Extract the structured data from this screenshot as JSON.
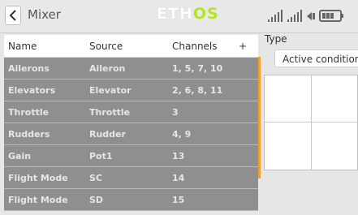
{
  "header": {
    "title": "Mixer",
    "logo_main": "ETH",
    "logo_accent": "OS"
  },
  "table": {
    "columns": [
      "Name",
      "Source",
      "Channels",
      "+"
    ],
    "rows": [
      {
        "name": "Ailerons",
        "source": "Aileron",
        "channels": "1, 5, 7, 10"
      },
      {
        "name": "Elevators",
        "source": "Elevator",
        "channels": "2, 6, 8, 11"
      },
      {
        "name": "Throttle",
        "source": "Throttle",
        "channels": "3"
      },
      {
        "name": "Rudders",
        "source": "Rudder",
        "channels": "4, 9"
      },
      {
        "name": "Gain",
        "source": "Pot1",
        "channels": "13"
      },
      {
        "name": "Flight Mode",
        "source": "SC",
        "channels": "14"
      },
      {
        "name": "Flight Mode",
        "source": "SD",
        "channels": "15"
      }
    ]
  },
  "details": {
    "type_label": "Type",
    "type_value": "Active condition"
  },
  "colors": {
    "accent": "#b5e51d",
    "row_bg": "#8f8f8f",
    "scroll": "#f0a030"
  }
}
